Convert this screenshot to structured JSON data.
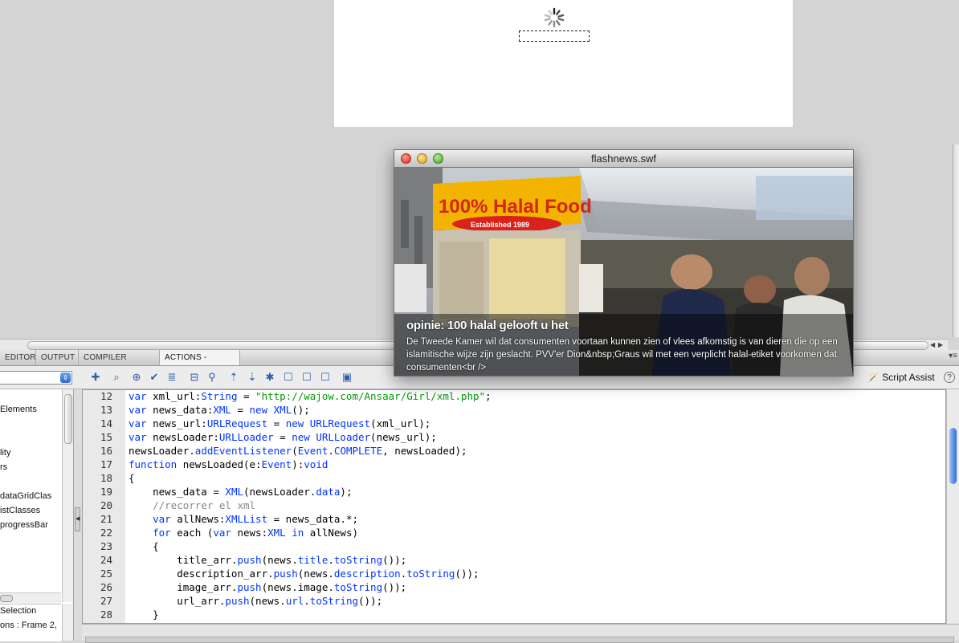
{
  "tabs": [
    "EDITOR",
    "OUTPUT",
    "COMPILER ERRORS",
    "ACTIONS - FRAME"
  ],
  "active_tab": "ACTIONS - FRAME",
  "toolbar": {
    "script_assist_label": "Script Assist",
    "help_label": "?"
  },
  "left_panel": {
    "tree_items": [
      "Elements",
      "lity",
      "rs",
      "dataGridClas",
      "istClasses",
      "progressBar"
    ],
    "lower_items": [
      "Selection",
      "ons : Frame 2,"
    ]
  },
  "code": {
    "line_numbers": [
      "12",
      "13",
      "14",
      "15",
      "16",
      "17",
      "18",
      "19",
      "20",
      "21",
      "22",
      "23",
      "24",
      "25",
      "26",
      "27",
      "28"
    ]
  },
  "swf_window": {
    "title": "flashnews.swf",
    "sign_text": "100% Halal Food",
    "sign_sub": "Established 1989",
    "news_title": "opinie: 100 halal gelooft u het",
    "news_description": "De Tweede Kamer wil dat consumenten voortaan kunnen zien of vlees afkomstig is van dieren die op een islamitische wijze zijn geslacht. PVV'er Dion&nbsp;Graus wil met een verplicht halal-etiket voorkomen dat consumenten<br />"
  },
  "colors": {
    "keyword": "#0033ff",
    "string": "#009900",
    "comment": "#888888",
    "sign_yellow": "#f2b400"
  }
}
